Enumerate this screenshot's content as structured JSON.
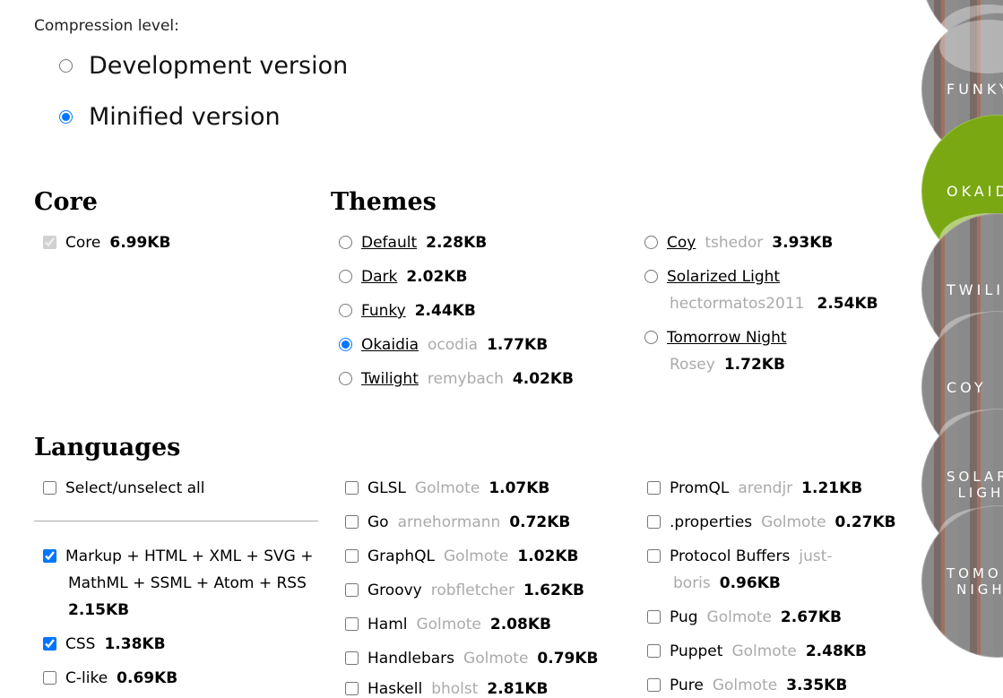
{
  "compression": {
    "label": "Compression level:",
    "options": [
      {
        "label": "Development version",
        "checked": false
      },
      {
        "label": "Minified version",
        "checked": true
      }
    ]
  },
  "core": {
    "heading": "Core",
    "items": [
      {
        "name": "Core",
        "size": "6.99KB",
        "checked": true
      }
    ]
  },
  "themes": {
    "heading": "Themes",
    "items": [
      {
        "name": "Default",
        "author": "",
        "size": "2.28KB",
        "checked": false
      },
      {
        "name": "Dark",
        "author": "",
        "size": "2.02KB",
        "checked": false
      },
      {
        "name": "Funky",
        "author": "",
        "size": "2.44KB",
        "checked": false
      },
      {
        "name": "Okaidia",
        "author": "ocodia",
        "size": "1.77KB",
        "checked": true
      },
      {
        "name": "Twilight",
        "author": "remybach",
        "size": "4.02KB",
        "checked": false
      },
      {
        "name": "Coy",
        "author": "tshedor",
        "size": "3.93KB",
        "checked": false
      },
      {
        "name": "Solarized Light",
        "author": "hectormatos2011",
        "size": "2.54KB",
        "checked": false
      },
      {
        "name": "Tomorrow Night",
        "author": "Rosey",
        "size": "1.72KB",
        "checked": false
      }
    ]
  },
  "languages": {
    "heading": "Languages",
    "select_all_label": "Select/unselect all",
    "col1": [
      {
        "name": "Markup + HTML + XML + SVG +",
        "name2": "MathML + SSML + Atom + RSS",
        "size": "2.15KB",
        "checked": true
      },
      {
        "name": "CSS",
        "size": "1.38KB",
        "checked": true
      },
      {
        "name": "C-like",
        "size": "0.69KB",
        "checked": false
      }
    ],
    "col2": [
      {
        "name": "GLSL",
        "author": "Golmote",
        "size": "1.07KB"
      },
      {
        "name": "Go",
        "author": "arnehormann",
        "size": "0.72KB"
      },
      {
        "name": "GraphQL",
        "author": "Golmote",
        "size": "1.02KB"
      },
      {
        "name": "Groovy",
        "author": "robfletcher",
        "size": "1.62KB"
      },
      {
        "name": "Haml",
        "author": "Golmote",
        "size": "2.08KB"
      },
      {
        "name": "Handlebars",
        "author": "Golmote",
        "size": "0.79KB"
      },
      {
        "name": "Haskell",
        "author": "bholst",
        "size": "2.81KB"
      }
    ],
    "col3": [
      {
        "name": "PromQL",
        "author": "arendjr",
        "size": "1.21KB"
      },
      {
        "name": ".properties",
        "author": "Golmote",
        "size": "0.27KB"
      },
      {
        "name": "Protocol Buffers",
        "author": "just-",
        "author2": "boris",
        "size": "0.96KB"
      },
      {
        "name": "Pug",
        "author": "Golmote",
        "size": "2.67KB"
      },
      {
        "name": "Puppet",
        "author": "Golmote",
        "size": "2.48KB"
      },
      {
        "name": "Pure",
        "author": "Golmote",
        "size": "3.35KB"
      }
    ]
  },
  "theme_previews": [
    {
      "label": "",
      "active": false
    },
    {
      "label": "FUNKY",
      "active": false
    },
    {
      "label": "OKAIDIA",
      "active": true
    },
    {
      "label": "TWILIGHT",
      "active": false
    },
    {
      "label": "COY",
      "active": false
    },
    {
      "label": "SOLARIZED LIGHT",
      "active": false
    },
    {
      "label": "TOMORROW NIGHT",
      "active": false
    }
  ],
  "colors": {
    "accent": "#7aa813",
    "author_gray": "#aaaaaa"
  }
}
